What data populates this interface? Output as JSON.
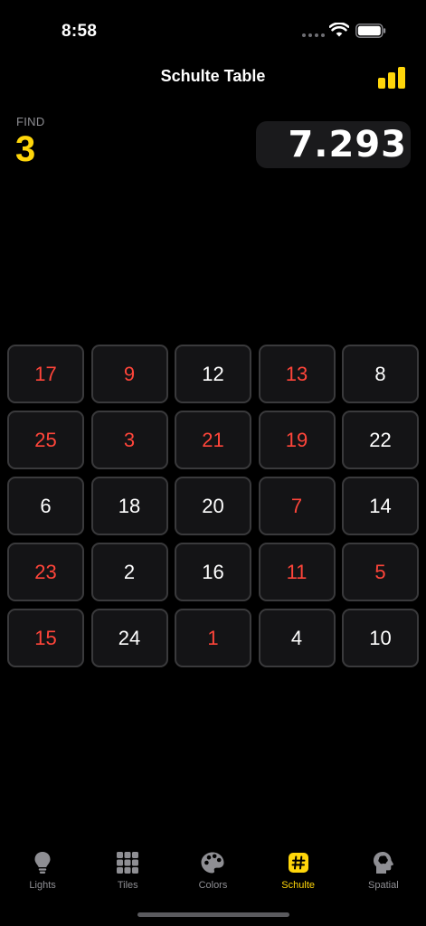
{
  "status": {
    "time": "8:58"
  },
  "nav": {
    "title": "Schulte Table"
  },
  "find": {
    "label": "FIND",
    "value": "3"
  },
  "timer": {
    "value": "7.293"
  },
  "grid": {
    "cells": [
      {
        "n": "17",
        "red": true
      },
      {
        "n": "9",
        "red": true
      },
      {
        "n": "12",
        "red": false
      },
      {
        "n": "13",
        "red": true
      },
      {
        "n": "8",
        "red": false
      },
      {
        "n": "25",
        "red": true
      },
      {
        "n": "3",
        "red": true
      },
      {
        "n": "21",
        "red": true
      },
      {
        "n": "19",
        "red": true
      },
      {
        "n": "22",
        "red": false
      },
      {
        "n": "6",
        "red": false
      },
      {
        "n": "18",
        "red": false
      },
      {
        "n": "20",
        "red": false
      },
      {
        "n": "7",
        "red": true
      },
      {
        "n": "14",
        "red": false
      },
      {
        "n": "23",
        "red": true
      },
      {
        "n": "2",
        "red": false
      },
      {
        "n": "16",
        "red": false
      },
      {
        "n": "11",
        "red": true
      },
      {
        "n": "5",
        "red": true
      },
      {
        "n": "15",
        "red": true
      },
      {
        "n": "24",
        "red": false
      },
      {
        "n": "1",
        "red": true
      },
      {
        "n": "4",
        "red": false
      },
      {
        "n": "10",
        "red": false
      }
    ]
  },
  "tabs": [
    {
      "label": "Lights",
      "icon": "lightbulb-icon",
      "active": false
    },
    {
      "label": "Tiles",
      "icon": "grid-icon",
      "active": false
    },
    {
      "label": "Colors",
      "icon": "palette-icon",
      "active": false
    },
    {
      "label": "Schulte",
      "icon": "hash-icon",
      "active": true
    },
    {
      "label": "Spatial",
      "icon": "brain-head-icon",
      "active": false
    }
  ],
  "colors": {
    "accent": "#ffd60a",
    "red": "#ff453a",
    "inactive": "#8e8e93",
    "background": "#000000"
  }
}
